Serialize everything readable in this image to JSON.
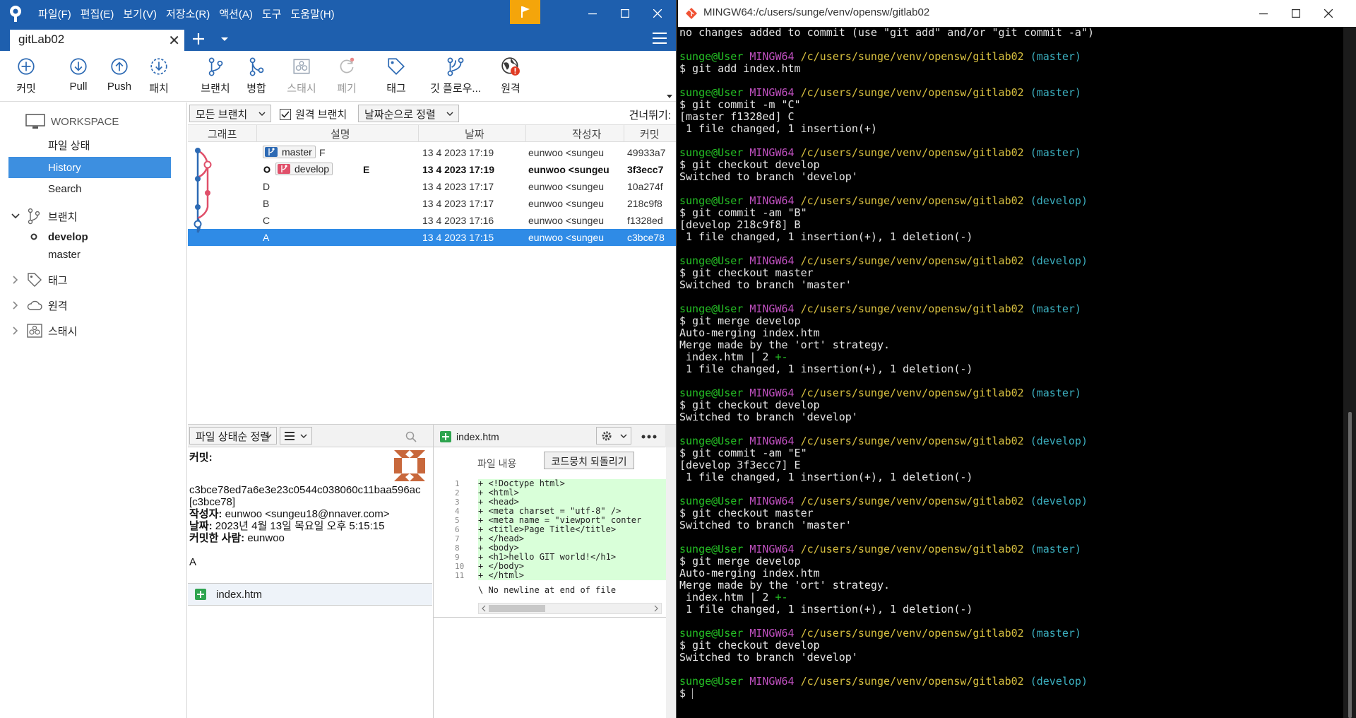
{
  "sourcetree": {
    "menu": [
      "파일(F)",
      "편집(E)",
      "보기(V)",
      "저장소(R)",
      "액션(A)",
      "도구",
      "도움말(H)"
    ],
    "tab_title": "gitLab02",
    "toolbar": [
      {
        "label": "커밋",
        "icon": "commit-plus-icon"
      },
      {
        "label": "Pull",
        "icon": "pull-down-icon"
      },
      {
        "label": "Push",
        "icon": "push-up-icon"
      },
      {
        "label": "패치",
        "icon": "patch-icon"
      },
      {
        "label": "브랜치",
        "icon": "branch-icon"
      },
      {
        "label": "병합",
        "icon": "merge-icon"
      },
      {
        "label": "스태시",
        "icon": "stash-icon",
        "disabled": true
      },
      {
        "label": "폐기",
        "icon": "discard-icon",
        "disabled": true
      },
      {
        "label": "태그",
        "icon": "tag-icon"
      },
      {
        "label": "깃 플로우...",
        "icon": "git-flow-icon"
      },
      {
        "label": "원격",
        "icon": "remote-globe-icon",
        "badge": "!"
      }
    ],
    "sidebar": {
      "workspace_label": "WORKSPACE",
      "workspace_items": [
        "파일 상태",
        "History",
        "Search"
      ],
      "selected": "History",
      "branches_label": "브랜치",
      "branches": [
        {
          "name": "develop",
          "current": true
        },
        {
          "name": "master",
          "current": false
        }
      ],
      "tags_label": "태그",
      "remotes_label": "원격",
      "stash_label": "스태시"
    },
    "filter": {
      "all_branches": "모든 브랜치",
      "remote_branches": "원격 브랜치",
      "remote_checked": true,
      "sort": "날짜순으로 정렬",
      "skip_label": "건너뛰기:"
    },
    "columns": [
      "그래프",
      "설명",
      "날짜",
      "작성자",
      "커밋"
    ],
    "commits": [
      {
        "desc": "F",
        "date": "13 4 2023 17:19",
        "author": "eunwoo <sungeu",
        "hash": "49933a7",
        "tag": "master",
        "bold": false,
        "selected": false
      },
      {
        "desc": "E",
        "date": "13 4 2023 17:19",
        "author": "eunwoo <sungeu",
        "hash": "3f3ecc7",
        "tag": "develop",
        "bold": true,
        "selected": false
      },
      {
        "desc": "D",
        "date": "13 4 2023 17:17",
        "author": "eunwoo <sungeu",
        "hash": "10a274f",
        "tag": "",
        "bold": false,
        "selected": false
      },
      {
        "desc": "B",
        "date": "13 4 2023 17:17",
        "author": "eunwoo <sungeu",
        "hash": "218c9f8",
        "tag": "",
        "bold": false,
        "selected": false
      },
      {
        "desc": "C",
        "date": "13 4 2023 17:16",
        "author": "eunwoo <sungeu",
        "hash": "f1328ed",
        "tag": "",
        "bold": false,
        "selected": false
      },
      {
        "desc": "A",
        "date": "13 4 2023 17:15",
        "author": "eunwoo <sungeu",
        "hash": "c3bce78",
        "tag": "",
        "bold": false,
        "selected": true
      }
    ],
    "lower": {
      "sort": "파일 상태순 정렬",
      "commit_label": "커밋:",
      "commit_hash": "c3bce78ed7a6e3e23c0544c038060c11baa596ac",
      "commit_short": "[c3bce78]",
      "author_label": "작성자:",
      "author": "eunwoo <sungeu18@nnaver.com>",
      "date_label": "날짜:",
      "date": "2023년 4월 13일 목요일 오후 5:15:15",
      "committer_label": "커밋한 사람:",
      "committer": "eunwoo",
      "message": "A",
      "file": "index.htm"
    },
    "diff": {
      "file": "index.htm",
      "content_label": "파일 내용",
      "revert_button": "코드뭉치 되돌리기",
      "lines": [
        {
          "n": "1",
          "code": "+ <!Doctype html>"
        },
        {
          "n": "2",
          "code": "+ <html>"
        },
        {
          "n": "3",
          "code": "+ <head>"
        },
        {
          "n": "4",
          "code": "+ <meta charset = \"utf-8\" />"
        },
        {
          "n": "5",
          "code": "+ <meta name = \"viewport\" conter"
        },
        {
          "n": "6",
          "code": "+ <title>Page Title</title>"
        },
        {
          "n": "7",
          "code": "+ </head>"
        },
        {
          "n": "8",
          "code": "+ <body>"
        },
        {
          "n": "9",
          "code": "+ <h1>hello GIT world!</h1>"
        },
        {
          "n": "10",
          "code": "+ </body>"
        },
        {
          "n": "11",
          "code": "+ </html>"
        }
      ],
      "no_newline": "\\  No newline at end of file"
    }
  },
  "terminal": {
    "title": "MINGW64:/c/users/sunge/venv/opensw/gitlab02",
    "prompt_user": "sunge@User",
    "prompt_host": "MINGW64",
    "prompt_path": "/c/users/sunge/venv/opensw/gitlab02",
    "lines": [
      {
        "t": "out",
        "text": "no changes added to commit (use \"git add\" and/or \"git commit -a\")"
      },
      {
        "t": "blank"
      },
      {
        "t": "prompt",
        "branch": "(master)"
      },
      {
        "t": "out",
        "text": "$ git add index.htm"
      },
      {
        "t": "blank"
      },
      {
        "t": "prompt",
        "branch": "(master)"
      },
      {
        "t": "out",
        "text": "$ git commit -m \"C\""
      },
      {
        "t": "out",
        "text": "[master f1328ed] C"
      },
      {
        "t": "out",
        "text": " 1 file changed, 1 insertion(+)"
      },
      {
        "t": "blank"
      },
      {
        "t": "prompt",
        "branch": "(master)"
      },
      {
        "t": "out",
        "text": "$ git checkout develop"
      },
      {
        "t": "out",
        "text": "Switched to branch 'develop'"
      },
      {
        "t": "blank"
      },
      {
        "t": "prompt",
        "branch": "(develop)"
      },
      {
        "t": "out",
        "text": "$ git commit -am \"B\""
      },
      {
        "t": "out",
        "text": "[develop 218c9f8] B"
      },
      {
        "t": "out",
        "text": " 1 file changed, 1 insertion(+), 1 deletion(-)"
      },
      {
        "t": "blank"
      },
      {
        "t": "prompt",
        "branch": "(develop)"
      },
      {
        "t": "out",
        "text": "$ git checkout master"
      },
      {
        "t": "out",
        "text": "Switched to branch 'master'"
      },
      {
        "t": "blank"
      },
      {
        "t": "prompt",
        "branch": "(master)"
      },
      {
        "t": "out",
        "text": "$ git merge develop"
      },
      {
        "t": "out",
        "text": "Auto-merging index.htm"
      },
      {
        "t": "out",
        "text": "Merge made by the 'ort' strategy."
      },
      {
        "t": "diffstat",
        "text": " index.htm | 2 ",
        "pm": "+-"
      },
      {
        "t": "out",
        "text": " 1 file changed, 1 insertion(+), 1 deletion(-)"
      },
      {
        "t": "blank"
      },
      {
        "t": "prompt",
        "branch": "(master)"
      },
      {
        "t": "out",
        "text": "$ git checkout develop"
      },
      {
        "t": "out",
        "text": "Switched to branch 'develop'"
      },
      {
        "t": "blank"
      },
      {
        "t": "prompt",
        "branch": "(develop)"
      },
      {
        "t": "out",
        "text": "$ git commit -am \"E\""
      },
      {
        "t": "out",
        "text": "[develop 3f3ecc7] E"
      },
      {
        "t": "out",
        "text": " 1 file changed, 1 insertion(+), 1 deletion(-)"
      },
      {
        "t": "blank"
      },
      {
        "t": "prompt",
        "branch": "(develop)"
      },
      {
        "t": "out",
        "text": "$ git checkout master"
      },
      {
        "t": "out",
        "text": "Switched to branch 'master'"
      },
      {
        "t": "blank"
      },
      {
        "t": "prompt",
        "branch": "(master)"
      },
      {
        "t": "out",
        "text": "$ git merge develop"
      },
      {
        "t": "out",
        "text": "Auto-merging index.htm"
      },
      {
        "t": "out",
        "text": "Merge made by the 'ort' strategy."
      },
      {
        "t": "diffstat",
        "text": " index.htm | 2 ",
        "pm": "+-"
      },
      {
        "t": "out",
        "text": " 1 file changed, 1 insertion(+), 1 deletion(-)"
      },
      {
        "t": "blank"
      },
      {
        "t": "prompt",
        "branch": "(master)"
      },
      {
        "t": "out",
        "text": "$ git checkout develop"
      },
      {
        "t": "out",
        "text": "Switched to branch 'develop'"
      },
      {
        "t": "blank"
      },
      {
        "t": "prompt",
        "branch": "(develop)"
      },
      {
        "t": "out",
        "text": "$ "
      }
    ]
  },
  "colors": {
    "sourcetree_blue": "#1e5fae",
    "selection_blue": "#2f8be6",
    "flag_orange": "#f4a50b",
    "term_green": "#25c025",
    "term_magenta": "#c050c0",
    "term_yellow": "#d8c040",
    "term_cyan": "#3cb0c0"
  }
}
